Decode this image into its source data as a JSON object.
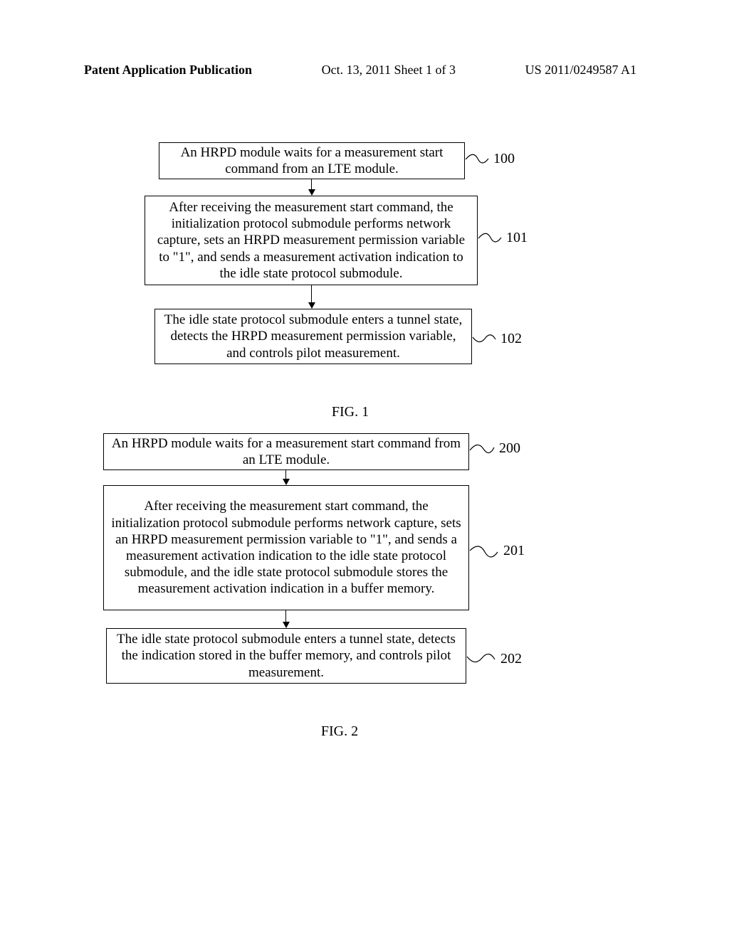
{
  "header": {
    "left": "Patent Application Publication",
    "center": "Oct. 13, 2011  Sheet 1 of 3",
    "right": "US 2011/0249587 A1"
  },
  "fig1": {
    "caption": "FIG. 1",
    "boxes": {
      "b100": "An HRPD module waits for a measurement start command from an LTE module.",
      "b101": "After receiving the measurement start command, the initialization protocol submodule performs network capture, sets an HRPD measurement permission variable to \"1\", and sends a measurement activation indication to the idle state protocol submodule.",
      "b102": "The idle state protocol submodule enters a tunnel state, detects the HRPD measurement permission variable, and controls pilot measurement."
    },
    "refs": {
      "r100": "100",
      "r101": "101",
      "r102": "102"
    }
  },
  "fig2": {
    "caption": "FIG. 2",
    "boxes": {
      "b200": "An HRPD module waits for a measurement start command from an LTE module.",
      "b201": "After receiving the measurement start command, the initialization protocol submodule performs network capture, sets an HRPD measurement permission variable to \"1\", and sends a measurement activation indication to the idle state protocol submodule, and the idle state protocol submodule stores the measurement activation indication in a buffer memory.",
      "b202": "The idle state protocol submodule enters a tunnel state, detects the indication stored in the buffer memory, and controls pilot measurement."
    },
    "refs": {
      "r200": "200",
      "r201": "201",
      "r202": "202"
    }
  }
}
